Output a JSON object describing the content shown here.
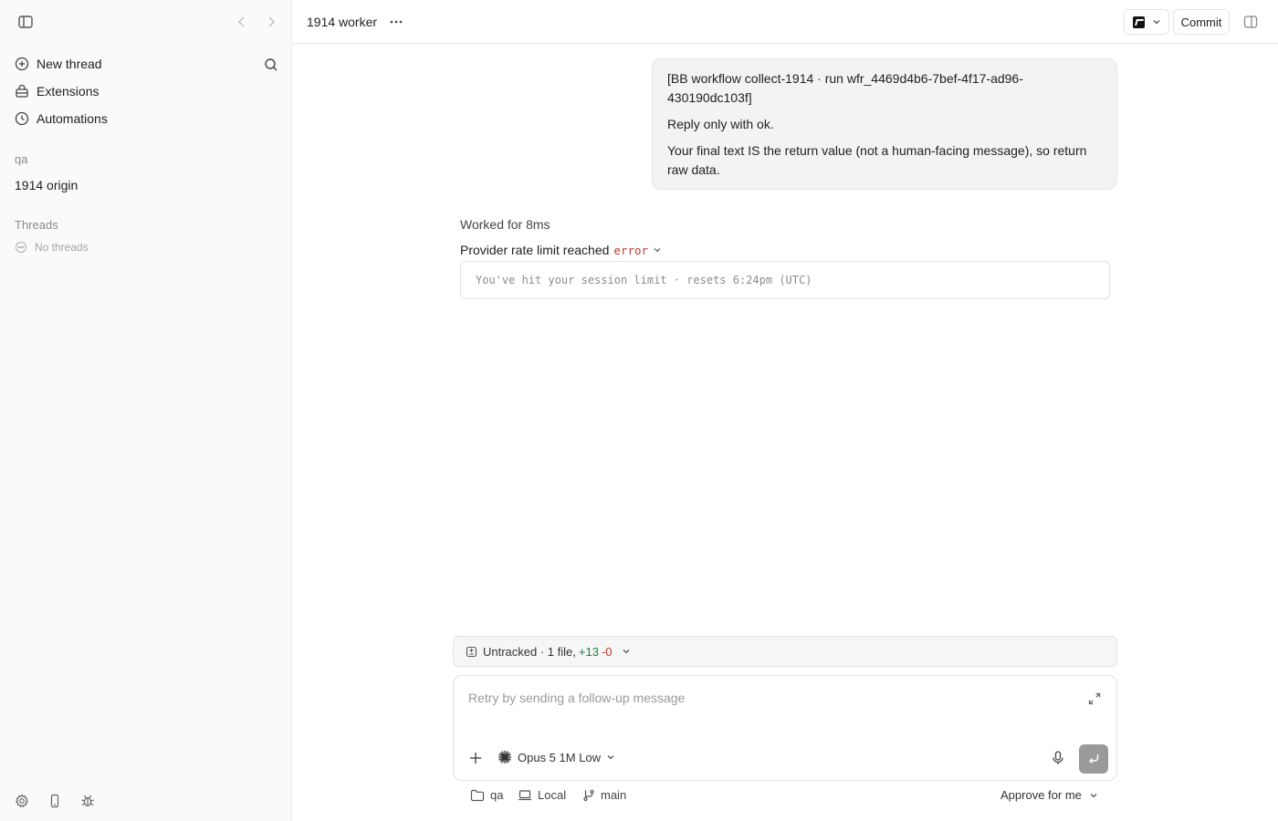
{
  "sidebar": {
    "nav": [
      {
        "label": "New thread",
        "icon": "plus-circle-icon"
      },
      {
        "label": "Extensions",
        "icon": "extensions-icon"
      },
      {
        "label": "Automations",
        "icon": "clock-icon"
      }
    ],
    "project_section": "qa",
    "project_item": "1914 origin",
    "threads_section": "Threads",
    "threads_empty": "No threads"
  },
  "header": {
    "title": "1914 worker",
    "commit_label": "Commit"
  },
  "conversation": {
    "user_message": [
      "[BB workflow collect-1914 · run wfr_4469d4b6-7bef-4f17-ad96-430190dc103f]",
      "Reply only with ok.",
      "Your final text IS the return value (not a human-facing message), so return raw data."
    ],
    "worked_for": "Worked for 8ms",
    "error_title": "Provider rate limit reached",
    "error_tag": "error",
    "error_detail": "You've hit your session limit · resets 6:24pm (UTC)"
  },
  "untracked": {
    "label": "Untracked · 1 file,",
    "additions": "+13",
    "deletions": "-0"
  },
  "composer": {
    "placeholder": "Retry by sending a follow-up message",
    "model": "Opus 5 1M Low"
  },
  "footer": {
    "folder": "qa",
    "environment": "Local",
    "branch": "main",
    "approval": "Approve for me"
  },
  "colors": {
    "error": "#c0392b",
    "additions": "#1a7f37",
    "send_button": "#9a9a9a"
  }
}
